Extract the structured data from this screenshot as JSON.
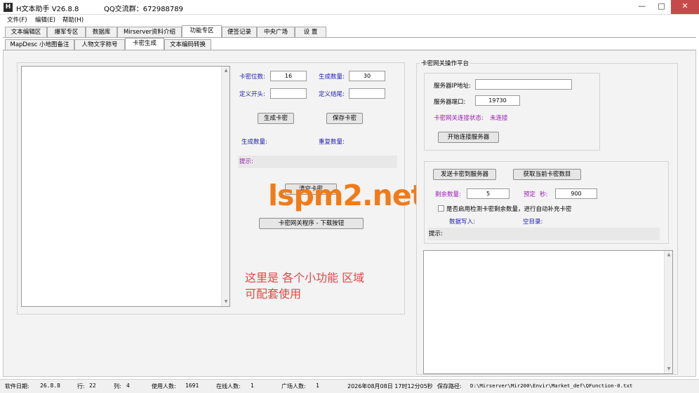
{
  "window": {
    "app_icon": "H",
    "title": "H文本助手  V26.8.8",
    "qq_group": "QQ交流群：672988789",
    "controls": {
      "minimize": "—",
      "maximize": "□",
      "close": "✕"
    }
  },
  "menu": [
    "文件(F)",
    "编辑(E)",
    "帮助(H)"
  ],
  "tabs_main": [
    "文本编辑区",
    "爆军专区",
    "数据库",
    "Mirserver资料介绍",
    "功能专区",
    "便签记录",
    "中央广场",
    "设  置"
  ],
  "tabs_sub": [
    "MapDesc 小地图备注",
    "人物文字称号",
    "卡密生成",
    "文本编码转换"
  ],
  "card_gen": {
    "digits_label": "卡密位数:",
    "digits_value": "16",
    "count_label": "生成数量:",
    "count_value": "30",
    "prefix_label": "定义开头:",
    "prefix_value": "",
    "suffix_label": "定义结尾:",
    "suffix_value": "",
    "generate_button": "生成卡密",
    "save_button": "保存卡密",
    "generated_count_label": "生成数量:",
    "duplicate_count_label": "重复数量:",
    "hint_label": "提示:",
    "clear_button": "清空卡密",
    "download_button": "卡密网关程序 - 下载按钮"
  },
  "watermark": "lspm2.net",
  "annotation": {
    "line1": "这里是  各个小功能 区域",
    "line2": "可配套使用"
  },
  "gateway": {
    "group_title": "卡密网关操作平台",
    "server_ip_label": "服务器IP地址:",
    "server_ip_value": "",
    "server_port_label": "服务器端口:",
    "server_port_value": "19730",
    "status_label": "卡密网关连接状态:",
    "status_value": "未连接",
    "connect_button": "开始连接服务器",
    "send_button": "发送卡密到服务器",
    "fetch_button": "获取当前卡密数目",
    "remaining_label": "剩余数量:",
    "remaining_value": "5",
    "preset_label": "预定",
    "seconds_label": "秒:",
    "seconds_value": "900",
    "auto_refill_label": "是否启用检测卡密剩余数量，进行自动补充卡密",
    "auto_refill_checked": false,
    "data_write_label": "数据写入:",
    "empty_dir_label": "空目录:",
    "hint_label": "提示:"
  },
  "statusbar": {
    "software_date_label": "软件日期:",
    "software_date_value": "26.8.8",
    "row_label": "行:",
    "row_value": "22",
    "col_label": "列:",
    "col_value": "4",
    "users_label": "使用人数:",
    "users_value": "1691",
    "online_label": "在线人数:",
    "online_value": "1",
    "plaza_label": "广场人数:",
    "plaza_value": "1",
    "datetime": "2026年08月08日 17时12分05秒",
    "path_label": "保存路径:",
    "path_value": "D:\\Mirserver\\Mir200\\Envir\\Market_def\\QFunction-0.txt"
  },
  "colors": {
    "watermark": "#f07b1a",
    "annotation": "#e54545",
    "blue_label": "#1b1bb3",
    "purple_label": "#9a1ab3",
    "close_button": "#c74a4a"
  }
}
